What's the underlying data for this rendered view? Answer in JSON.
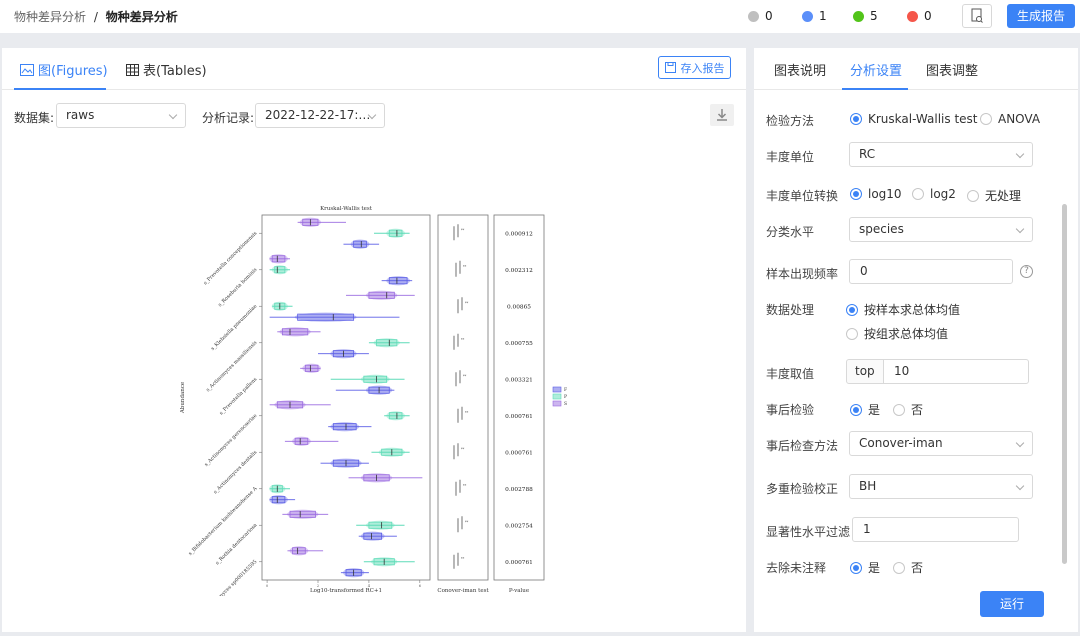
{
  "header": {
    "breadcrumb_parent": "物种差异分析",
    "breadcrumb_sep": "/",
    "breadcrumb_current": "物种差异分析",
    "stats": [
      {
        "icon": "clock-icon",
        "color": "#bfbfbf",
        "value": "0"
      },
      {
        "icon": "running-icon",
        "color": "#5b8ff9",
        "value": "1"
      },
      {
        "icon": "check-icon",
        "color": "#52c41a",
        "value": "5"
      },
      {
        "icon": "error-icon",
        "color": "#f5564a",
        "value": "0"
      }
    ],
    "generate_label": "生成报告"
  },
  "left": {
    "tab_figures": "图(Figures)",
    "tab_tables": "表(Tables)",
    "save_label": "存入报告",
    "dataset_label": "数据集:",
    "dataset_value": "raws",
    "record_label": "分析记录:",
    "record_value": "2022-12-22-17:…"
  },
  "right": {
    "tabs": [
      "图表说明",
      "分析设置",
      "图表调整"
    ],
    "test_method": {
      "label": "检验方法",
      "options": [
        "Kruskal-Wallis test",
        "ANOVA"
      ],
      "selected": 0
    },
    "abundance_unit": {
      "label": "丰度单位",
      "value": "RC"
    },
    "unit_transform": {
      "label": "丰度单位转换",
      "options": [
        "log10",
        "log2",
        "无处理"
      ],
      "selected": 0
    },
    "taxonomy_level": {
      "label": "分类水平",
      "value": "species"
    },
    "occurrence": {
      "label": "样本出现频率",
      "value": "0"
    },
    "processing": {
      "label": "数据处理",
      "options": [
        "按样本求总体均值",
        "按组求总体均值"
      ],
      "selected": 0
    },
    "abundance_take": {
      "label": "丰度取值",
      "prefix": "top",
      "value": "10"
    },
    "post_hoc": {
      "label": "事后检验",
      "options": [
        "是",
        "否"
      ],
      "selected": 0
    },
    "post_hoc_method": {
      "label": "事后检查方法",
      "value": "Conover-iman"
    },
    "correction": {
      "label": "多重检验校正",
      "value": "BH"
    },
    "sig_filter": {
      "label": "显著性水平过滤",
      "value": "1"
    },
    "remove_unannotated": {
      "label": "去除未注释",
      "options": [
        "是",
        "否"
      ],
      "selected": 0
    },
    "run_label": "运行"
  },
  "chart_data": {
    "type": "boxplot",
    "title": "Kruskal-Wallis test",
    "ylabel": "Abundance",
    "xlabel": "Log10-transformed RC+1",
    "posthoc_label": "Conover-iman test",
    "pvalue_label": "P-value",
    "xlim": [
      -0.2,
      6.4
    ],
    "groups": [
      "F",
      "P",
      "S"
    ],
    "group_colors": [
      "#5b5ee6",
      "#5fdcb8",
      "#9a6be0"
    ],
    "species": [
      {
        "name": "s_Prevotella conceptionensis",
        "p": "0.000912",
        "boxes": [
          [
            3.0,
            3.4,
            3.7,
            3.9,
            4.4
          ],
          [
            4.2,
            4.8,
            5.1,
            5.3,
            5.6
          ],
          [
            1.2,
            1.4,
            1.7,
            2.0,
            3.1
          ]
        ]
      },
      {
        "name": "s_Roseburia hominis",
        "p": "0.002312",
        "boxes": [
          [
            4.5,
            4.8,
            5.1,
            5.5,
            5.7
          ],
          [
            0.1,
            0.3,
            0.4,
            0.7,
            0.9
          ],
          [
            0.1,
            0.2,
            0.4,
            0.7,
            0.9
          ]
        ]
      },
      {
        "name": "s_Klebsiella pneumoniae",
        "p": "0.00865",
        "boxes": [
          [
            0.1,
            1.2,
            2.6,
            3.4,
            5.2
          ],
          [
            0.2,
            0.3,
            0.5,
            0.7,
            1.0
          ],
          [
            3.1,
            4.0,
            4.7,
            5.0,
            5.8
          ]
        ]
      },
      {
        "name": "s_Actinomyces massiliensis",
        "p": "0.000755",
        "boxes": [
          [
            2.0,
            2.6,
            3.0,
            3.4,
            4.0
          ],
          [
            4.0,
            4.3,
            4.8,
            5.1,
            5.6
          ],
          [
            0.4,
            0.6,
            0.9,
            1.6,
            2.1
          ]
        ]
      },
      {
        "name": "s_Prevotella pallens",
        "p": "0.003321",
        "boxes": [
          [
            2.7,
            4.0,
            4.4,
            4.8,
            5.0
          ],
          [
            2.5,
            3.8,
            4.3,
            4.7,
            5.4
          ],
          [
            1.3,
            1.5,
            1.7,
            2.0,
            2.1
          ]
        ]
      },
      {
        "name": "s_Actinomyces gerencseriae",
        "p": "0.000761",
        "boxes": [
          [
            2.4,
            2.6,
            3.1,
            3.5,
            4.1
          ],
          [
            4.6,
            4.8,
            5.1,
            5.3,
            5.6
          ],
          [
            0.1,
            0.4,
            0.9,
            1.4,
            2.5
          ]
        ]
      },
      {
        "name": "s_Actinomyces dentalis",
        "p": "0.000761",
        "boxes": [
          [
            2.1,
            2.6,
            3.1,
            3.6,
            4.0
          ],
          [
            4.1,
            4.5,
            4.9,
            5.3,
            5.6
          ],
          [
            0.7,
            1.1,
            1.3,
            1.6,
            2.8
          ]
        ]
      },
      {
        "name": "s_Bifidobacterium kashiwanohense A",
        "p": "0.002788",
        "boxes": [
          [
            0.1,
            0.2,
            0.4,
            0.7,
            1.1
          ],
          [
            0.1,
            0.2,
            0.4,
            0.6,
            0.9
          ],
          [
            3.2,
            3.8,
            4.3,
            4.8,
            6.1
          ]
        ]
      },
      {
        "name": "s_Rothia dentocariosa",
        "p": "0.002754",
        "boxes": [
          [
            3.6,
            3.8,
            4.1,
            4.5,
            5.1
          ],
          [
            3.5,
            4.0,
            4.5,
            4.9,
            5.4
          ],
          [
            0.6,
            0.9,
            1.3,
            1.9,
            2.4
          ]
        ]
      },
      {
        "name": "s_Actinomyces sp000185595",
        "p": "0.000761",
        "boxes": [
          [
            2.9,
            3.1,
            3.4,
            3.7,
            4.0
          ],
          [
            3.8,
            4.2,
            4.6,
            5.0,
            5.8
          ],
          [
            0.8,
            1.0,
            1.2,
            1.5,
            2.2
          ]
        ]
      }
    ]
  }
}
